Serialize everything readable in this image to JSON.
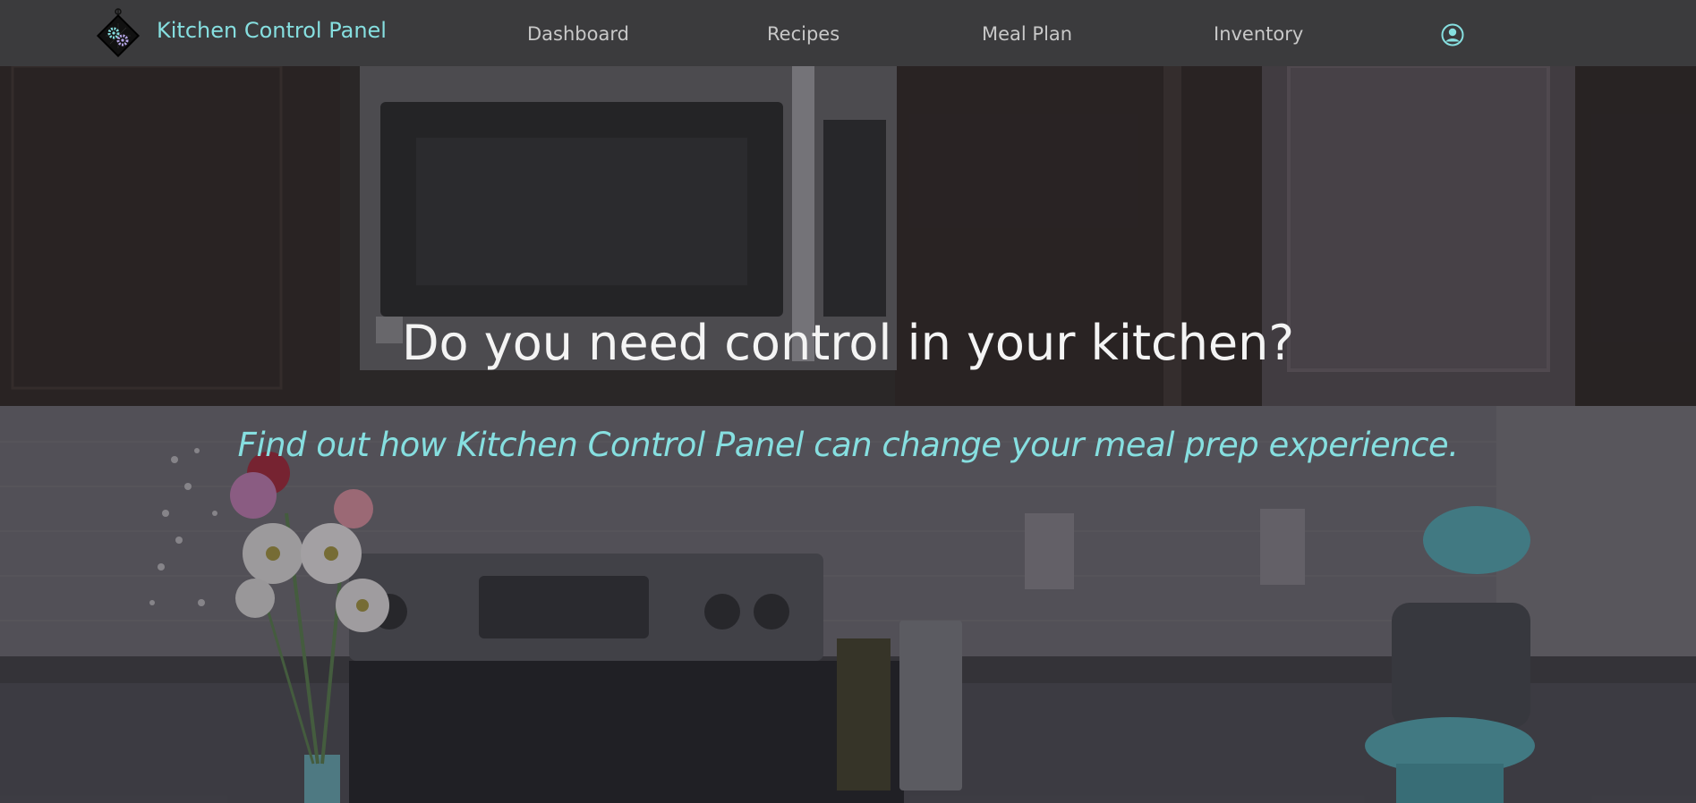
{
  "brand": {
    "name": "Kitchen Control Panel",
    "logo_icon": "potholder-gears-icon"
  },
  "nav": {
    "items": [
      {
        "label": "Dashboard"
      },
      {
        "label": "Recipes"
      },
      {
        "label": "Meal Plan"
      },
      {
        "label": "Inventory"
      }
    ],
    "user_icon": "user-circle-icon"
  },
  "hero": {
    "title": "Do you need control in your kitchen?",
    "subtitle": "Find out how Kitchen Control Panel can change your meal prep experience."
  },
  "colors": {
    "accent": "#86dfe0",
    "navbar_bg": "#3b3b3d",
    "nav_text": "#c8c8c8",
    "hero_text": "#f4f4f4"
  }
}
